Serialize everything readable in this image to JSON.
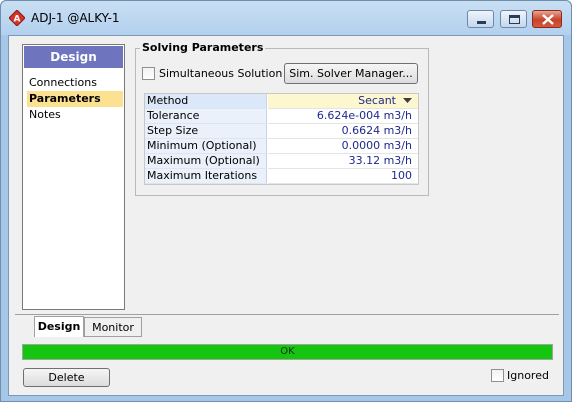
{
  "window": {
    "title": "ADJ-1 @ALKY-1",
    "accent_title_gradient": [
      "#c9dff3",
      "#b3d0ee"
    ],
    "icon": "red-diamond-a-icon"
  },
  "nav": {
    "header": "Design",
    "items": [
      {
        "label": "Connections",
        "selected": false
      },
      {
        "label": "Parameters",
        "selected": true
      },
      {
        "label": "Notes",
        "selected": false
      }
    ],
    "header_color": "#6e74bd",
    "selected_color": "#fbe190"
  },
  "solving": {
    "title": "Solving Parameters",
    "simultaneous_label": "Simultaneous Solution",
    "simultaneous_checked": false,
    "solver_manager_button": "Sim. Solver Manager...",
    "params": [
      {
        "label": "Method",
        "value": "Secant"
      },
      {
        "label": "Tolerance",
        "value": "6.624e-004 m3/h"
      },
      {
        "label": "Step Size",
        "value": "0.6624 m3/h"
      },
      {
        "label": "Minimum (Optional)",
        "value": "0.0000 m3/h"
      },
      {
        "label": "Maximum (Optional)",
        "value": "33.12 m3/h"
      },
      {
        "label": "Maximum Iterations",
        "value": "100"
      }
    ]
  },
  "tabs": [
    {
      "label": "Design",
      "active": true
    },
    {
      "label": "Monitor",
      "active": false
    }
  ],
  "status": {
    "text": "OK",
    "color": "#16c50f"
  },
  "footer": {
    "delete_button": "Delete",
    "ignored_label": "Ignored",
    "ignored_checked": false
  }
}
